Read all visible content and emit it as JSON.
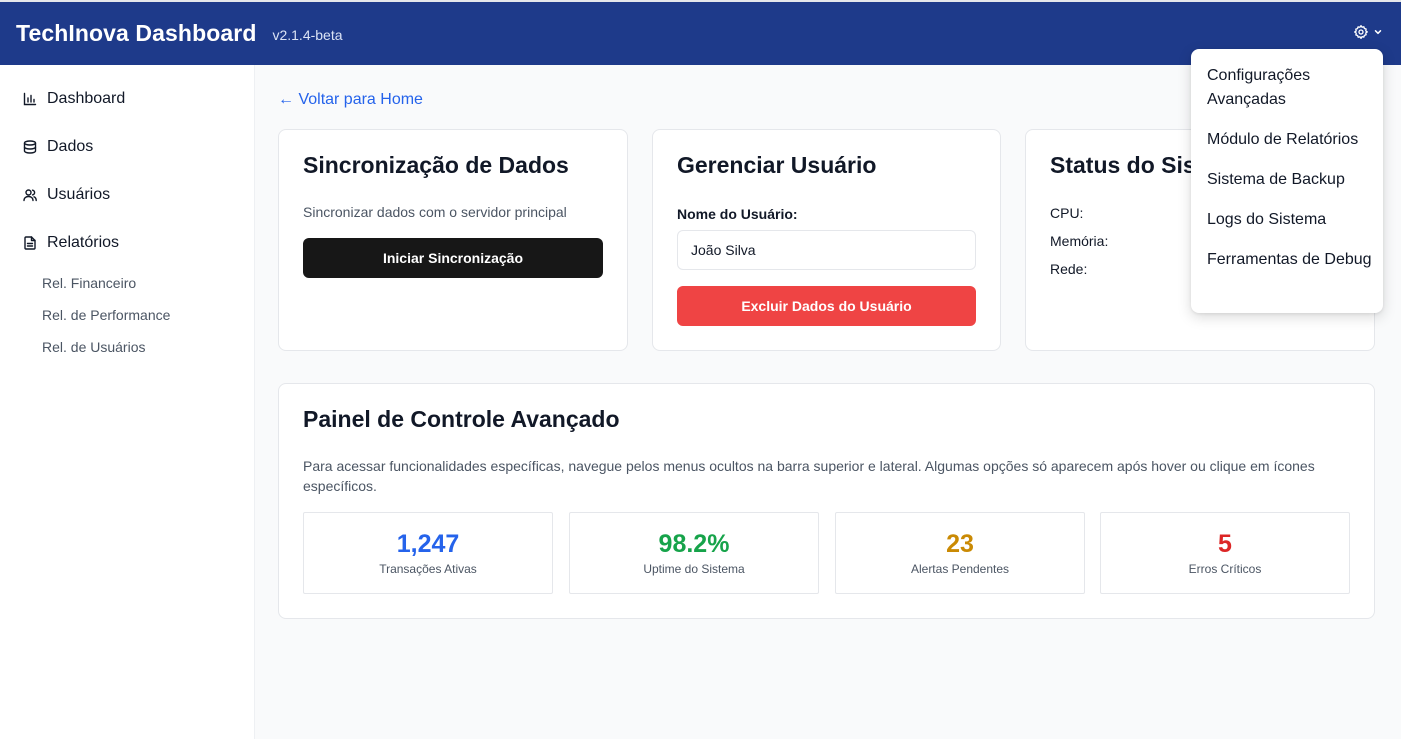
{
  "header": {
    "title": "TechInova Dashboard",
    "version": "v2.1.4-beta",
    "settings_icon": "gear-icon",
    "colors": {
      "background": "#1e3a8a",
      "text": "#ffffff"
    }
  },
  "sidebar": {
    "items": [
      {
        "label": "Dashboard",
        "icon": "bar-chart-icon"
      },
      {
        "label": "Dados",
        "icon": "database-icon"
      },
      {
        "label": "Usuários",
        "icon": "users-icon"
      },
      {
        "label": "Relatórios",
        "icon": "file-text-icon"
      }
    ],
    "sub_items": [
      "Rel. Financeiro",
      "Rel. de Performance",
      "Rel. de Usuários"
    ]
  },
  "back_link": "← Voltar para Home",
  "sync_card": {
    "title": "Sincronização de Dados",
    "description": "Sincronizar dados com o servidor principal",
    "button": "Iniciar Sincronização"
  },
  "user_card": {
    "title": "Gerenciar Usuário",
    "field_label": "Nome do Usuário:",
    "field_value": "João Silva",
    "button": "Excluir Dados do Usuário"
  },
  "status_card": {
    "title": "Status do Sistema",
    "labels": [
      "CPU:",
      "Memória:",
      "Rede:"
    ]
  },
  "panel": {
    "title": "Painel de Controle Avançado",
    "description": "Para acessar funcionalidades específicas, navegue pelos menus ocultos na barra superior e lateral. Algumas opções só aparecem após hover ou clique em ícones específicos.",
    "stats": [
      {
        "value": "1,247",
        "label": "Transações Ativas",
        "color": "#2563eb"
      },
      {
        "value": "98.2%",
        "label": "Uptime do Sistema",
        "color": "#16a34a"
      },
      {
        "value": "23",
        "label": "Alertas Pendentes",
        "color": "#ca8a04"
      },
      {
        "value": "5",
        "label": "Erros Críticos",
        "color": "#dc2626"
      }
    ]
  },
  "dropdown": {
    "items": [
      "Configurações Avançadas",
      "Módulo de Relatórios",
      "Sistema de Backup",
      "Logs do Sistema",
      "Ferramentas de Debug"
    ]
  }
}
